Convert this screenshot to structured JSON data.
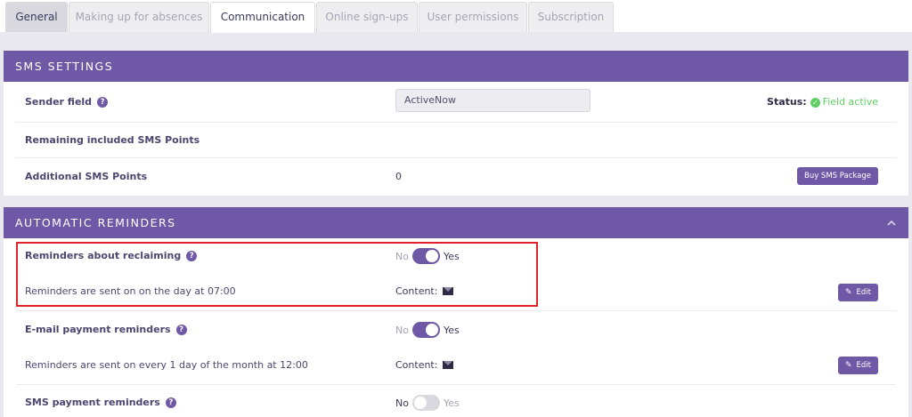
{
  "tabs": [
    {
      "label": "General"
    },
    {
      "label": "Making up for absences"
    },
    {
      "label": "Communication"
    },
    {
      "label": "Online sign-ups"
    },
    {
      "label": "User permissions"
    },
    {
      "label": "Subscription"
    }
  ],
  "sms": {
    "title": "SMS SETTINGS",
    "sender_label": "Sender field",
    "sender_value": "ActiveNow",
    "status_label": "Status:",
    "status_value": "Field active",
    "remaining_label": "Remaining included SMS Points",
    "additional_label": "Additional SMS Points",
    "additional_value": "0",
    "buy_button": "Buy SMS Package"
  },
  "reminders": {
    "title": "AUTOMATIC REMINDERS",
    "items": [
      {
        "label": "Reminders about reclaiming",
        "no": "No",
        "yes": "Yes",
        "enabled": true,
        "schedule": "Reminders are sent on on the day at 07:00",
        "content_label": "Content:",
        "edit": "Edit"
      },
      {
        "label": "E-mail payment reminders",
        "no": "No",
        "yes": "Yes",
        "enabled": true,
        "schedule": "Reminders are sent on every 1 day of the month at 12:00",
        "content_label": "Content:",
        "edit": "Edit"
      },
      {
        "label": "SMS payment reminders",
        "no": "No",
        "yes": "Yes",
        "enabled": false
      }
    ]
  },
  "colors": {
    "accent": "#6f58a5",
    "success": "#5fcf63",
    "highlight": "#e0232a"
  }
}
